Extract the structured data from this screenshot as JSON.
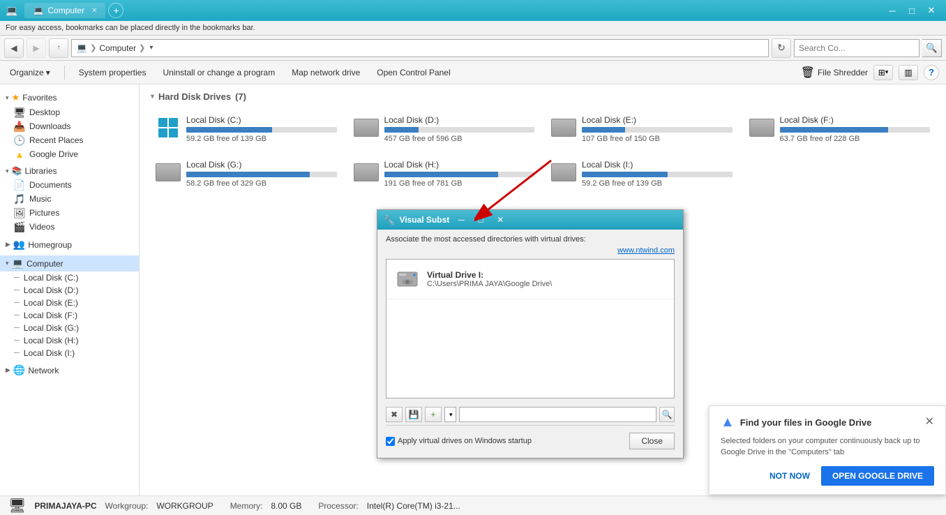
{
  "titleBar": {
    "icon": "💻",
    "title": "Computer",
    "tabs": [
      {
        "label": "Computer",
        "active": true
      }
    ],
    "minimize": "─",
    "maximize": "□",
    "close": "✕"
  },
  "bookmarkBar": {
    "message": "For easy access, bookmarks can be placed directly in the bookmarks bar."
  },
  "addressBar": {
    "back": "◀",
    "forward": "▶",
    "up": "↑",
    "path": "Computer",
    "pathFull": " ❯  Computer  ❯",
    "refresh": "↻",
    "searchPlaceholder": "Search Co...",
    "searchIcon": "🔍"
  },
  "toolbar": {
    "organize": "Organize",
    "organizeChevron": "▾",
    "systemProperties": "System properties",
    "uninstall": "Uninstall or change a program",
    "mapNetwork": "Map network drive",
    "openControlPanel": "Open Control Panel",
    "fileShredder": "File Shredder",
    "viewOptions": "≡",
    "help": "?"
  },
  "sidebar": {
    "favorites": {
      "label": "Favorites",
      "items": [
        {
          "icon": "🖥",
          "label": "Desktop"
        },
        {
          "icon": "📥",
          "label": "Downloads"
        },
        {
          "icon": "🕒",
          "label": "Recent Places"
        },
        {
          "icon": "▲",
          "label": "Google Drive"
        }
      ]
    },
    "libraries": {
      "label": "Libraries",
      "items": [
        {
          "icon": "📄",
          "label": "Documents"
        },
        {
          "icon": "🎵",
          "label": "Music"
        },
        {
          "icon": "🖼",
          "label": "Pictures"
        },
        {
          "icon": "🎬",
          "label": "Videos"
        }
      ]
    },
    "homegroup": {
      "label": "Homegroup"
    },
    "computer": {
      "label": "Computer",
      "items": [
        {
          "label": "Local Disk (C:)"
        },
        {
          "label": "Local Disk (D:)"
        },
        {
          "label": "Local Disk (E:)"
        },
        {
          "label": "Local Disk (F:)"
        },
        {
          "label": "Local Disk (G:)"
        },
        {
          "label": "Local Disk (H:)"
        },
        {
          "label": "Local Disk (I:)"
        }
      ]
    },
    "network": {
      "label": "Network"
    }
  },
  "content": {
    "sectionTitle": "Hard Disk Drives",
    "driveCount": "(7)",
    "drives": [
      {
        "name": "Local Disk (C:)",
        "freeSpace": "59.2 GB free of 139 GB",
        "fillPercent": 57,
        "type": "windows"
      },
      {
        "name": "Local Disk (D:)",
        "freeSpace": "457 GB free of 596 GB",
        "fillPercent": 23,
        "type": "hdd"
      },
      {
        "name": "Local Disk (E:)",
        "freeSpace": "107 GB free of 150 GB",
        "fillPercent": 29,
        "type": "hdd"
      },
      {
        "name": "Local Disk (F:)",
        "freeSpace": "63.7 GB free of 228 GB",
        "fillPercent": 72,
        "type": "hdd"
      },
      {
        "name": "Local Disk (G:)",
        "freeSpace": "58.2 GB free of 329 GB",
        "fillPercent": 82,
        "type": "hdd"
      },
      {
        "name": "Local Disk (H:)",
        "freeSpace": "191 GB free of 781 GB",
        "fillPercent": 76,
        "type": "hdd"
      },
      {
        "name": "Local Disk (I:)",
        "freeSpace": "59.2 GB free of 139 GB",
        "fillPercent": 57,
        "type": "hdd"
      }
    ]
  },
  "statusBar": {
    "pcName": "PRIMAJAYA-PC",
    "workgroupLabel": "Workgroup:",
    "workgroup": "WORKGROUP",
    "memoryLabel": "Memory:",
    "memory": "8.00 GB",
    "processorLabel": "Processor:",
    "processor": "Intel(R) Core(TM) i3-21..."
  },
  "dialog": {
    "title": "Visual Subst",
    "icon": "🔧",
    "description": "Associate the most accessed directories with virtual drives:",
    "link": "www.ntwind.com",
    "virtualDrives": [
      {
        "name": "Virtual Drive I:",
        "path": "C:\\Users\\PRIMA JAYA\\Google Drive\\"
      }
    ],
    "applyCheckbox": true,
    "applyLabel": "Apply virtual drives on Windows startup",
    "closeBtn": "Close",
    "minimize": "─",
    "maximize": "□",
    "close": "✕"
  },
  "googleDriveNotification": {
    "title": "Find your files in Google Drive",
    "body": "Selected folders on your computer continuously back up to Google Drive in the \"Computers\" tab",
    "notNow": "NOT NOW",
    "openBtn": "OPEN GOOGLE DRIVE",
    "close": "✕"
  }
}
